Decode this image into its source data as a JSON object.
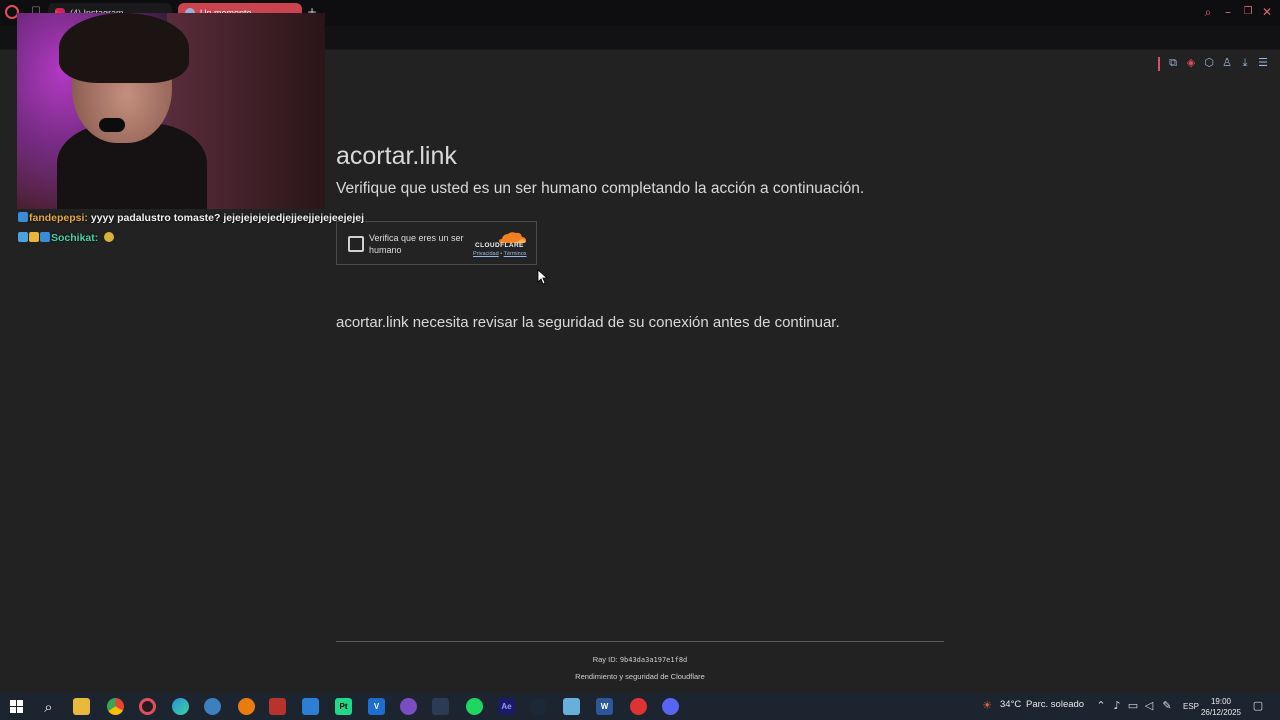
{
  "browser": {
    "tabs": [
      {
        "label": "(4) Instagram",
        "active": false
      },
      {
        "label": "Un momento…",
        "active": true
      }
    ],
    "new_tab_label": "+",
    "accent_color": "#e0505a"
  },
  "stream_overlay": {
    "chat": [
      {
        "user": "fandepepsi:",
        "message": "yyyy padalustro tomaste? jejejejejejedjejjeejjejejeejejej",
        "user_color": "#e8a93a"
      },
      {
        "user": "Sochikat:",
        "message": "",
        "user_color": "#44d3a7"
      }
    ]
  },
  "page": {
    "title": "acortar.link",
    "subtitle": "Verifique que usted es un ser humano completando la acción a continuación.",
    "turnstile": {
      "checkbox_label": "Verifica que eres un ser humano",
      "brand": "CLOUDFLARE",
      "privacy_link": "Privacidad",
      "separator": "•",
      "terms_link": "Términos",
      "brand_color": "#f38020"
    },
    "security_message": "acortar.link necesita revisar la seguridad de su conexión antes de continuar.",
    "footer": {
      "ray_label": "Ray ID:",
      "ray_id": "9b43da3a197e1f8d",
      "credit_prefix": "Rendimiento y seguridad de",
      "credit_brand": "Cloudflare"
    }
  },
  "taskbar": {
    "weather": {
      "temperature": "34°C",
      "condition": "Parc. soleado"
    },
    "language": "ESP",
    "time": "19:00",
    "date": "26/12/2025",
    "apps": [
      "windows-start-icon",
      "search-icon",
      "file-explorer-icon",
      "chrome-icon",
      "opera-icon",
      "edge-icon",
      "app-icon",
      "blender-icon",
      "voice-app-icon",
      "photos-icon",
      "pycharm-icon",
      "visual-studio-icon",
      "obs-icon",
      "davinci-icon",
      "spotify-icon",
      "after-effects-icon",
      "steam-icon",
      "notepad-icon",
      "word-icon",
      "app-icon-2",
      "discord-icon"
    ]
  }
}
